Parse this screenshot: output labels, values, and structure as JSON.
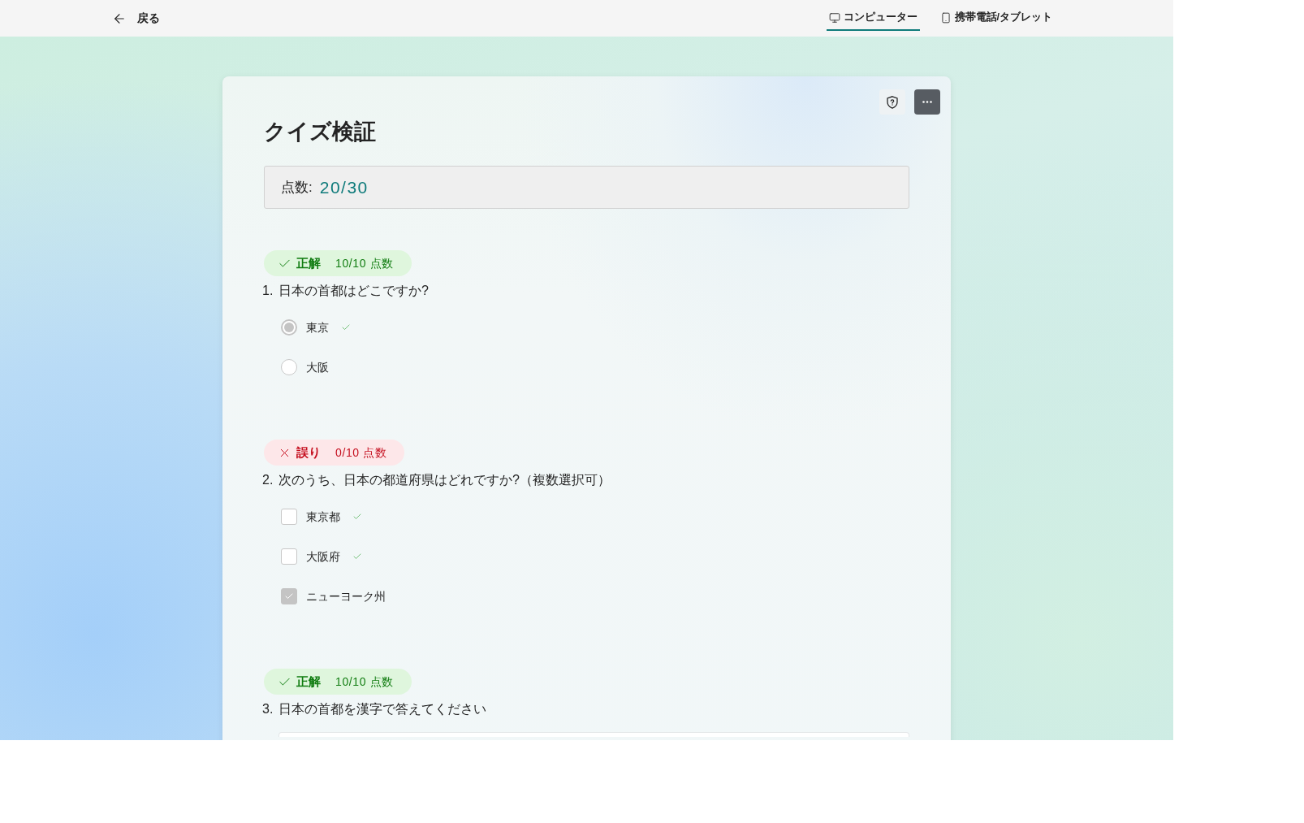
{
  "top_bar": {
    "back": {
      "label": "戻る"
    },
    "tabs": [
      {
        "label": "コンピューター",
        "selected": true
      },
      {
        "label": "携帯電話/タブレット",
        "selected": false
      }
    ]
  },
  "quiz": {
    "title": "クイズ検証",
    "score": {
      "label": "点数:",
      "value": "20/30"
    },
    "questions": [
      {
        "number": "1.",
        "text": "日本の首都はどこですか?",
        "kind": "single",
        "result": {
          "kind": "correct",
          "label": "正解",
          "points": "10/10 点数"
        },
        "options": [
          {
            "label": "東京",
            "selected": true,
            "correct": true
          },
          {
            "label": "大阪",
            "selected": false,
            "correct": false
          }
        ]
      },
      {
        "number": "2.",
        "text": "次のうち、日本の都道府県はどれですか?（複数選択可）",
        "kind": "multiple",
        "result": {
          "kind": "incorrect",
          "label": "誤り",
          "points": "0/10 点数"
        },
        "options": [
          {
            "label": "東京都",
            "checked": false,
            "correct": true
          },
          {
            "label": "大阪府",
            "checked": false,
            "correct": true
          },
          {
            "label": "ニューヨーク州",
            "checked": true,
            "correct": false
          }
        ]
      },
      {
        "number": "3.",
        "text": "日本の首都を漢字で答えてください",
        "kind": "text",
        "result": {
          "kind": "correct",
          "label": "正解",
          "points": "10/10 点数"
        }
      }
    ]
  }
}
